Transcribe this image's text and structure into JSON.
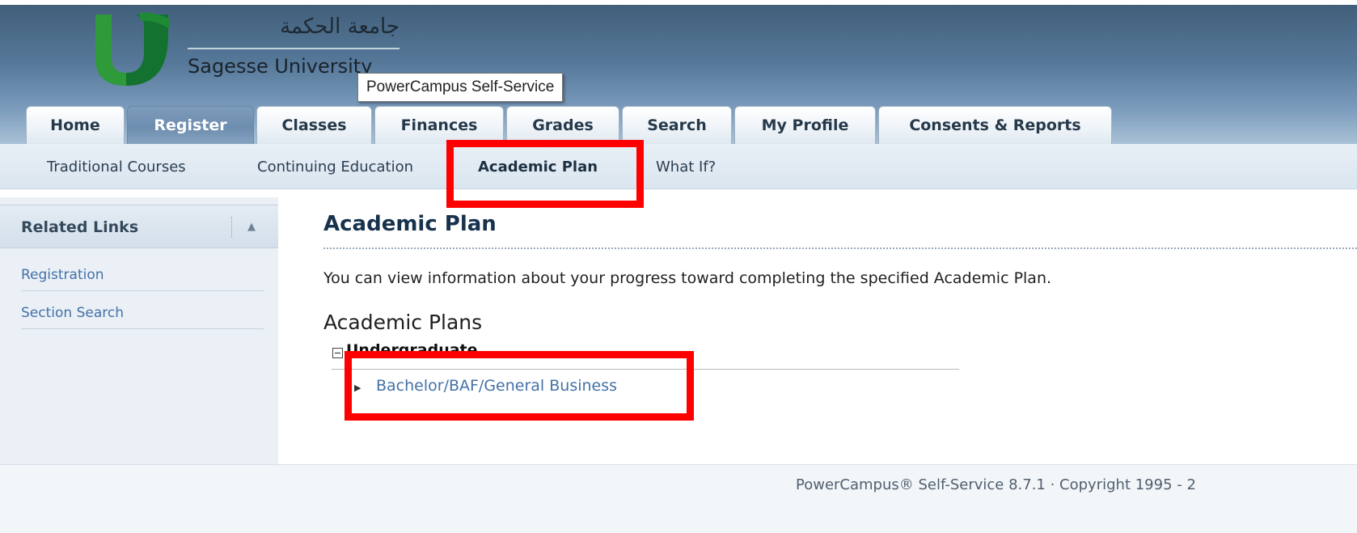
{
  "brand": {
    "arabic_name": "جامعة الحكمة",
    "english_name": "Sagesse University",
    "logo_colors": [
      "#2e9a3a",
      "#0f6a2c"
    ]
  },
  "tooltip": "PowerCampus Self-Service",
  "tabs": [
    {
      "label": "Home",
      "active": false
    },
    {
      "label": "Register",
      "active": true
    },
    {
      "label": "Classes",
      "active": false
    },
    {
      "label": "Finances",
      "active": false
    },
    {
      "label": "Grades",
      "active": false
    },
    {
      "label": "Search",
      "active": false
    },
    {
      "label": "My Profile",
      "active": false
    },
    {
      "label": "Consents & Reports",
      "active": false
    }
  ],
  "subnav": [
    {
      "label": "Traditional Courses",
      "active": false
    },
    {
      "label": "Continuing Education",
      "active": false
    },
    {
      "label": "Academic Plan",
      "active": true
    },
    {
      "label": "What If?",
      "active": false
    }
  ],
  "sidebar": {
    "title": "Related Links",
    "collapse_icon": "▲",
    "links": [
      "Registration",
      "Section Search"
    ]
  },
  "main": {
    "title": "Academic Plan",
    "intro": "You can view information about your progress toward completing the specified Academic Plan.",
    "plans_heading": "Academic Plans",
    "group_label": "Undergraduate",
    "plan_link": "Bachelor/BAF/General Business"
  },
  "footer": {
    "text": "PowerCampus® Self-Service 8.7.1 · Copyright 1995 - 2"
  },
  "colors": {
    "highlight": "#ff0000",
    "link": "#4471a8",
    "active_tab": "#6d8daf"
  }
}
